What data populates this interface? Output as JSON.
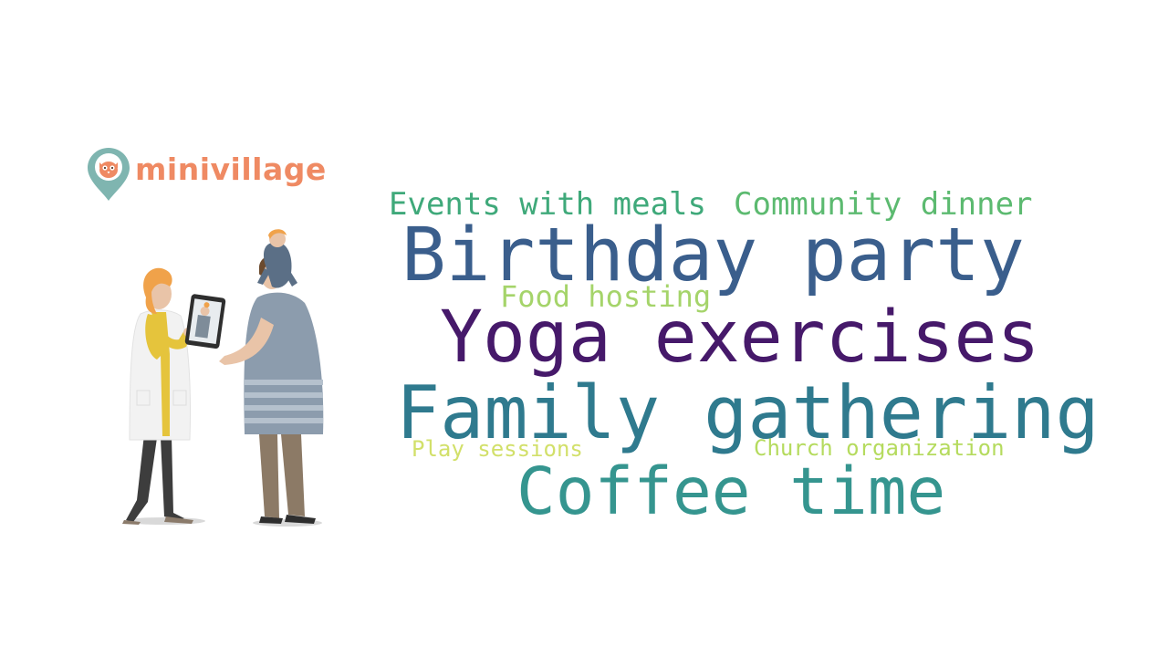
{
  "brand": {
    "name": "minivillage",
    "logo_icon": "map-pin-owl-icon",
    "name_color": "#ef8a63",
    "pin_color": "#7fb5b0"
  },
  "illustration": {
    "icon": "people-with-tablet-illustration"
  },
  "word_cloud": {
    "words": [
      {
        "key": "events_with_meals",
        "text": "Events with meals",
        "color": "#3fa97a"
      },
      {
        "key": "community_dinner",
        "text": "Community dinner",
        "color": "#5cba70"
      },
      {
        "key": "birthday_party",
        "text": "Birthday party",
        "color": "#3a5e8c"
      },
      {
        "key": "food_hosting",
        "text": "Food hosting",
        "color": "#a5d46a"
      },
      {
        "key": "yoga_exercises",
        "text": "Yoga exercises",
        "color": "#46196a"
      },
      {
        "key": "family_gathering",
        "text": "Family gathering",
        "color": "#2f7a8e"
      },
      {
        "key": "play_sessions",
        "text": "Play sessions",
        "color": "#d2e06a"
      },
      {
        "key": "church_organization",
        "text": "Church organization",
        "color": "#b5db5e"
      },
      {
        "key": "coffee_time",
        "text": "Coffee time",
        "color": "#35958f"
      }
    ]
  }
}
